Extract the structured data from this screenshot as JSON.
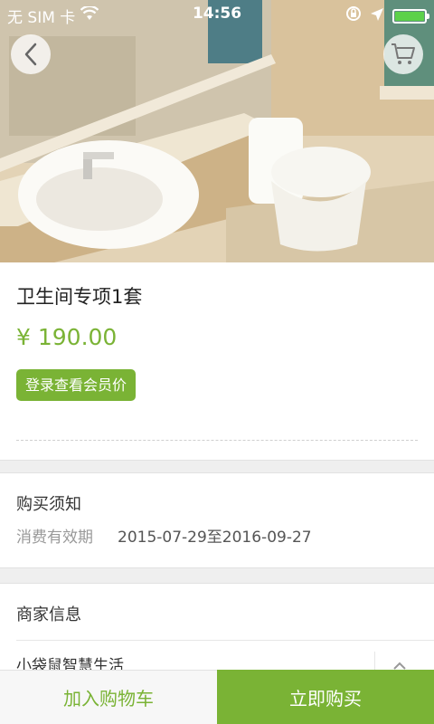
{
  "status_bar": {
    "carrier": "无 SIM 卡",
    "time": "14:56"
  },
  "product": {
    "image": "bathroom-photo",
    "title": "卫生间专项1套",
    "price": "¥ 190.00",
    "member_button_label": "登录查看会员价"
  },
  "purchase_notice": {
    "title": "购买须知",
    "validity_label": "消费有效期",
    "validity_value": "2015-07-29至2016-09-27"
  },
  "merchant": {
    "title": "商家信息",
    "name": "小袋鼠智慧生活"
  },
  "actions": {
    "add_to_cart_label": "加入购物车",
    "buy_now_label": "立即购买"
  },
  "colors": {
    "accent": "#7ab335",
    "gap_background": "#efefef"
  },
  "icons": [
    "back-arrow-icon",
    "cart-icon",
    "wifi-icon",
    "lock-rotation-icon",
    "location-arrow-icon",
    "battery-icon"
  ]
}
